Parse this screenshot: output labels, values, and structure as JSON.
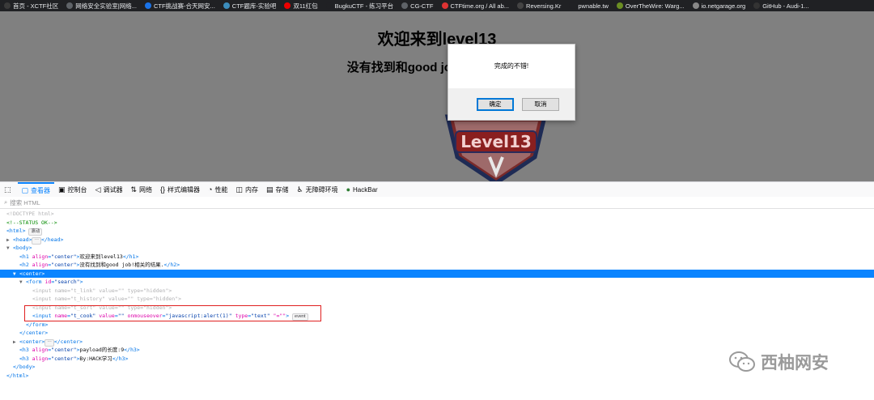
{
  "bookmarks": [
    {
      "label": "首页 - XCTF社区",
      "icon": "xctf-icon",
      "color": "#3a3a3a"
    },
    {
      "label": "网络安全实验室|网络...",
      "icon": "globe-icon",
      "color": "#5f6368"
    },
    {
      "label": "CTF挑战赛-合天网安...",
      "icon": "shield-icon",
      "color": "#1a73e8"
    },
    {
      "label": "CTF题库-实验吧",
      "icon": "flag-icon",
      "color": "#3c8dbc"
    },
    {
      "label": "双11红包",
      "icon": "t-icon",
      "color": "#e00"
    },
    {
      "label": "BugkuCTF - 练习平台",
      "icon": "bugku-icon",
      "color": "#202124"
    },
    {
      "label": "CG-CTF",
      "icon": "globe-icon",
      "color": "#5f6368"
    },
    {
      "label": "CTFtime.org / All ab...",
      "icon": "ctftime-icon",
      "color": "#d33"
    },
    {
      "label": "Reversing.Kr",
      "icon": "gear-icon",
      "color": "#444"
    },
    {
      "label": "pwnable.tw",
      "icon": "p-icon",
      "color": "#202124"
    },
    {
      "label": "OverTheWire: Warg...",
      "icon": "otw-icon",
      "color": "#6b8e23"
    },
    {
      "label": "io.netgarage.org",
      "icon": "page-icon",
      "color": "#888"
    },
    {
      "label": "GitHub - Audi-1...",
      "icon": "github-icon",
      "color": "#333"
    }
  ],
  "page": {
    "h1": "欢迎来到level13",
    "h2": "没有找到和good job!相关的结果."
  },
  "dialog": {
    "message": "完成的不错!",
    "ok_label": "确定",
    "cancel_label": "取消"
  },
  "devtools": {
    "tabs": [
      {
        "label": "查看器",
        "icon": "inspector-icon",
        "glyph": "▢",
        "active": true
      },
      {
        "label": "控制台",
        "icon": "console-icon",
        "glyph": "▣"
      },
      {
        "label": "调试器",
        "icon": "debugger-icon",
        "glyph": "◁"
      },
      {
        "label": "网络",
        "icon": "network-icon",
        "glyph": "⇅"
      },
      {
        "label": "样式编辑器",
        "icon": "style-editor-icon",
        "glyph": "{}"
      },
      {
        "label": "性能",
        "icon": "performance-icon",
        "glyph": "◔"
      },
      {
        "label": "内存",
        "icon": "memory-icon",
        "glyph": "◫"
      },
      {
        "label": "存储",
        "icon": "storage-icon",
        "glyph": "▤"
      },
      {
        "label": "无障碍环境",
        "icon": "accessibility-icon",
        "glyph": "♿"
      },
      {
        "label": "HackBar",
        "icon": "hackbar-icon",
        "glyph": "●"
      }
    ],
    "search_placeholder": "搜索 HTML",
    "lines": {
      "doctype": "<!DOCTYPE html>",
      "status_comment": "<!--STATUS OK-->",
      "html_open": "<html>",
      "html_badge": "滚动",
      "head_open": "<head>",
      "head_close": "</head>",
      "ellipsis": "⋯",
      "body_open": "<body>",
      "h1_tag": "h1",
      "h1_attr": "align",
      "h1_val": "\"center\"",
      "h1_text": "欢迎来到level13",
      "h2_tag": "h2",
      "h2_text": "没有找到和good job!相关的结果.",
      "center_open": "<center>",
      "form_tag": "form",
      "form_attr": "id",
      "form_val": "\"search\"",
      "input_tag": "input",
      "name_attr": "name",
      "value_attr": "value",
      "type_attr": "type",
      "empty_val": "\"\"",
      "hidden_val": "\"hidden\"",
      "t_link": "\"t_link\"",
      "t_history": "\"t_history\"",
      "t_sort": "\"t_sort\"",
      "t_cook": "\"t_cook\"",
      "onmouseover_attr": "onmouseover",
      "onmouseover_val": "\"javascript:alert(1)\"",
      "text_val": "\"text\"",
      "extra_attr": "\"=\"\"",
      "event_badge": "event",
      "form_close": "</form>",
      "center_close": "</center>",
      "center_collapsed": "</center>",
      "h3_tag": "h3",
      "h3a_text": "payload的长度:9",
      "h3b_text": "By:HACK学习",
      "body_close": "</body>",
      "html_close": "</html>"
    }
  },
  "watermark": "西柚网安"
}
